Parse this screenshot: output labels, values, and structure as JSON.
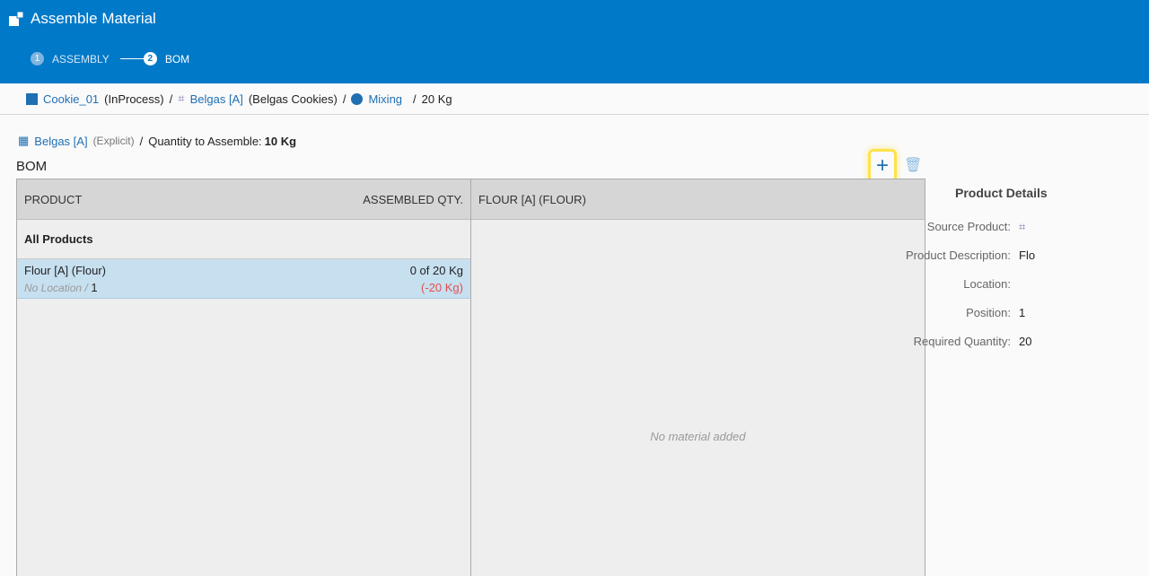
{
  "header": {
    "title": "Assemble Material",
    "steps": [
      {
        "num": "1",
        "label": "ASSEMBLY"
      },
      {
        "num": "2",
        "label": "BOM"
      }
    ]
  },
  "breadcrumb": {
    "material": "Cookie_01",
    "material_state": "(InProcess)",
    "product": "Belgas [A]",
    "product_desc": "(Belgas Cookies)",
    "step": "Mixing",
    "quantity": "20 Kg",
    "sep": "/"
  },
  "subheader": {
    "bom": "Belgas [A]",
    "bom_type": "(Explicit)",
    "qty_label": "Quantity to Assemble:",
    "qty_value": "10 Kg"
  },
  "bom": {
    "label": "BOM",
    "add_icon": "plus-icon",
    "delete_icon": "trash-icon",
    "left": {
      "col_product": "PRODUCT",
      "col_qty": "ASSEMBLED QTY.",
      "group": "All Products",
      "rows": [
        {
          "product": "Flour [A] (Flour)",
          "qty": "0 of 20 Kg",
          "location": "No Location /",
          "position": "1",
          "diff": "(-20 Kg)"
        }
      ]
    },
    "right": {
      "header": "FLOUR [A] (FLOUR)",
      "empty": "No material added"
    }
  },
  "details": {
    "title": "Product Details",
    "fields": [
      {
        "label": "Source Product:",
        "value": ""
      },
      {
        "label": "Product Description:",
        "value": "Flo"
      },
      {
        "label": "Location:",
        "value": ""
      },
      {
        "label": "Position:",
        "value": "1"
      },
      {
        "label": "Required Quantity:",
        "value": "20"
      }
    ]
  },
  "colors": {
    "header": "#0079c8",
    "link": "#1f6fb2",
    "selected_row": "#c7e0f0",
    "highlight": "#ffe24a",
    "negative": "#e05050"
  }
}
